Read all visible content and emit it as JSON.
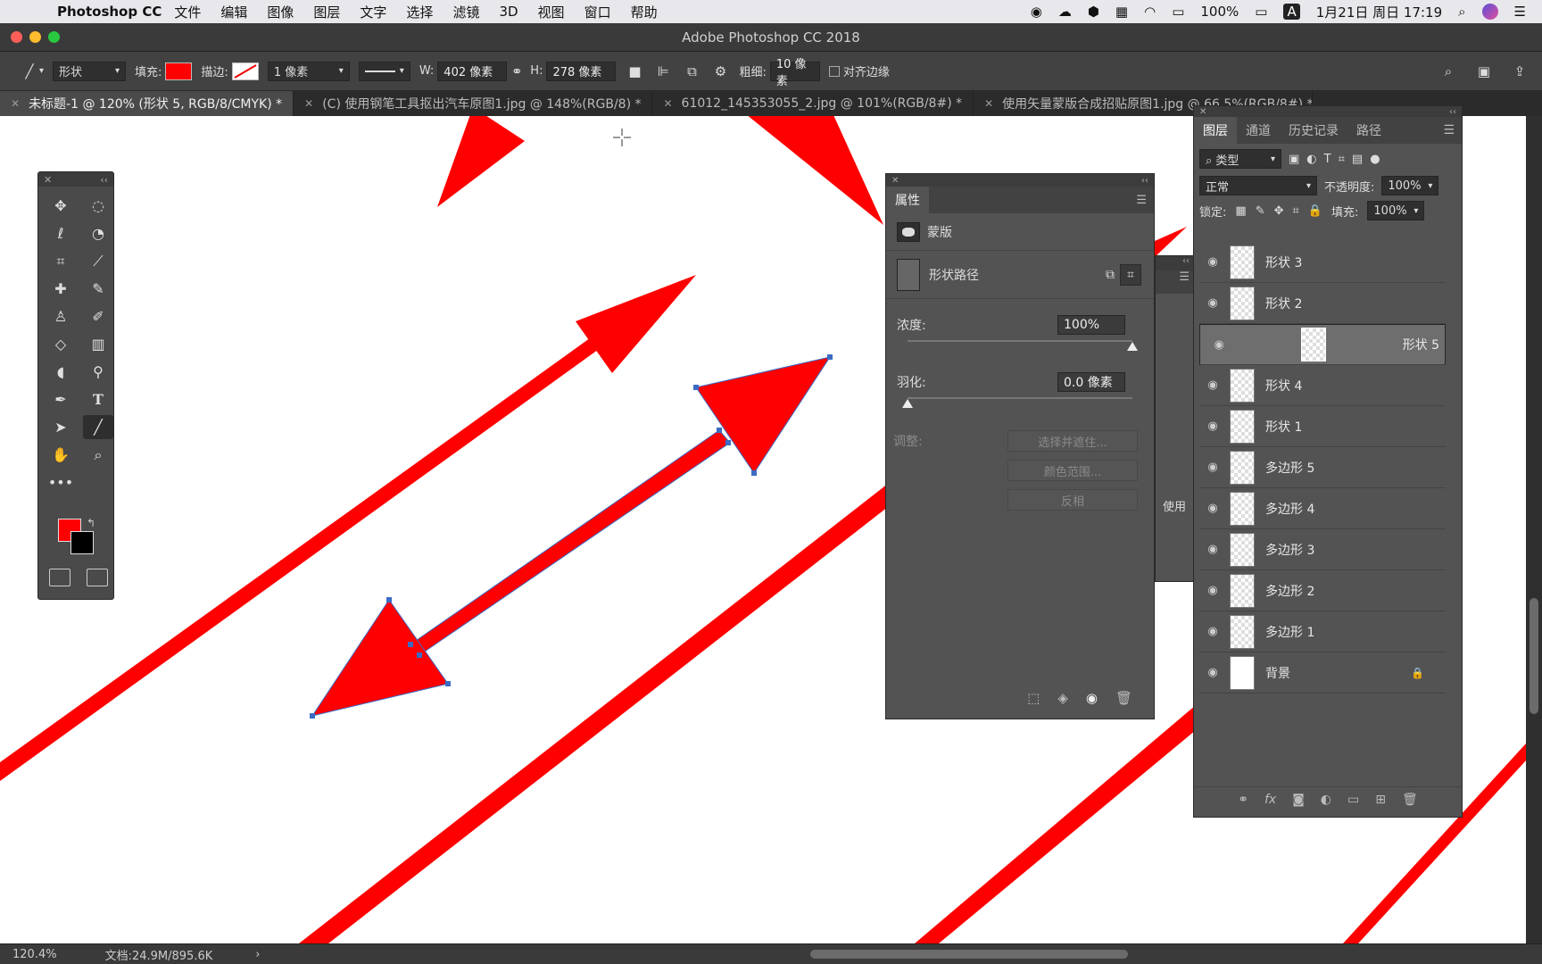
{
  "menubar": {
    "app": "Photoshop CC",
    "items": [
      "文件",
      "编辑",
      "图像",
      "图层",
      "文字",
      "选择",
      "滤镜",
      "3D",
      "视图",
      "窗口",
      "帮助"
    ],
    "battery": "100%",
    "input_method": "A",
    "datetime": "1月21日 周日  17:19"
  },
  "window": {
    "title": "Adobe Photoshop CC 2018"
  },
  "options": {
    "mode": "形状",
    "fill_label": "填充:",
    "fill_color": "#ff0000",
    "stroke_label": "描边:",
    "stroke_width": "1 像素",
    "w_label": "W:",
    "w_value": "402 像素",
    "h_label": "H:",
    "h_value": "278 像素",
    "weight_label": "粗细:",
    "weight_value": "10 像素",
    "align_edges": "对齐边缘"
  },
  "tabs": [
    {
      "label": "未标题-1 @ 120% (形状 5, RGB/8/CMYK) *"
    },
    {
      "label": "(C) 使用钢笔工具抠出汽车原图1.jpg @ 148%(RGB/8) *"
    },
    {
      "label": "61012_145353055_2.jpg @ 101%(RGB/8#) *"
    },
    {
      "label": "使用矢量蒙版合成招贴原图1.jpg @ 66.5%(RGB/8#) *"
    }
  ],
  "colors": {
    "foreground": "#ff0000",
    "background": "#000000",
    "shape_red": "#ff0000",
    "path_blue": "#3b6cc4"
  },
  "properties": {
    "tab": "属性",
    "mask_label": "蒙版",
    "shape_path_label": "形状路径",
    "density_label": "浓度:",
    "density_value": "100%",
    "density": 1.0,
    "feather_label": "羽化:",
    "feather_value": "0.0 像素",
    "feather": 0.0,
    "adjust_label": "调整:",
    "btn_select_mask": "选择并遮住...",
    "btn_color_range": "颜色范围...",
    "btn_invert": "反相",
    "ghost_text": "使用"
  },
  "layers_panel": {
    "tabs": [
      "图层",
      "通道",
      "历史记录",
      "路径"
    ],
    "filter": "类型",
    "blend_mode": "正常",
    "opacity_label": "不透明度:",
    "opacity_value": "100%",
    "lock_label": "锁定:",
    "fill_label": "填充:",
    "fill_value": "100%",
    "layers": [
      {
        "name": "形状 3"
      },
      {
        "name": "形状 2"
      },
      {
        "name": "形状 5"
      },
      {
        "name": "形状 4"
      },
      {
        "name": "形状 1"
      },
      {
        "name": "多边形 5"
      },
      {
        "name": "多边形 4"
      },
      {
        "name": "多边形 3"
      },
      {
        "name": "多边形 2"
      },
      {
        "name": "多边形 1"
      },
      {
        "name": "背景"
      }
    ]
  },
  "status": {
    "zoom": "120.4%",
    "doc": "文档:24.9M/895.6K"
  }
}
